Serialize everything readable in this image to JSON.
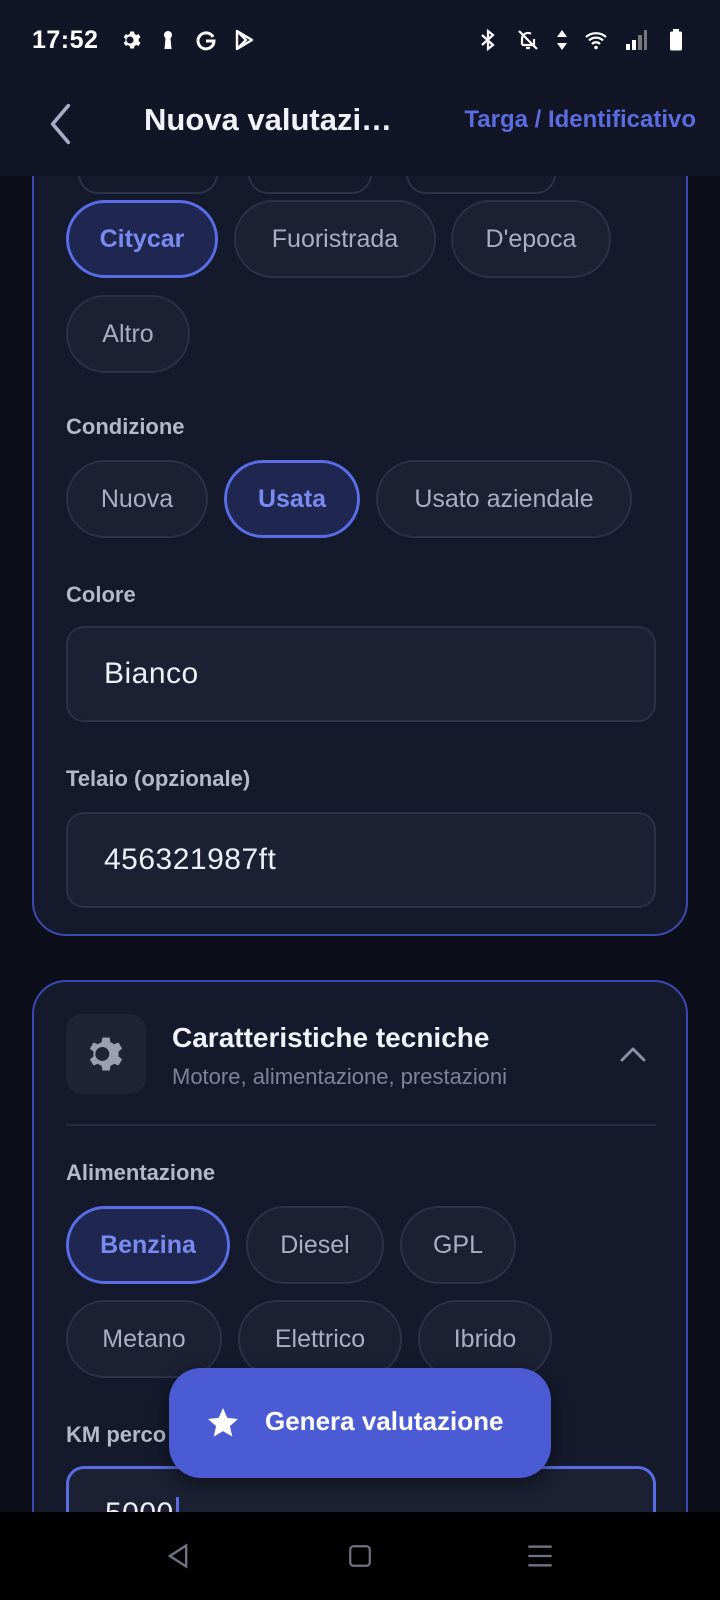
{
  "status_bar": {
    "time": "17:52",
    "left_icons": [
      "settings-icon",
      "keyhole-icon",
      "google-icon",
      "play-store-icon"
    ],
    "right_icons": [
      "bluetooth-icon",
      "bell-off-icon",
      "data-arrows-icon",
      "wifi-icon",
      "signal-icon",
      "battery-icon"
    ]
  },
  "app_bar": {
    "title": "Nuova valutazi…",
    "action": "Targa / Identificativo"
  },
  "vehicle_card": {
    "type_chips": [
      {
        "label": "Citycar",
        "selected": true
      },
      {
        "label": "Fuoristrada",
        "selected": false
      },
      {
        "label": "D'epoca",
        "selected": false
      },
      {
        "label": "Altro",
        "selected": false
      }
    ],
    "condition_label": "Condizione",
    "condition_chips": [
      {
        "label": "Nuova",
        "selected": false
      },
      {
        "label": "Usata",
        "selected": true
      },
      {
        "label": "Usato aziendale",
        "selected": false
      }
    ],
    "color_label": "Colore",
    "color_value": "Bianco",
    "chassis_label": "Telaio (opzionale)",
    "chassis_value": "456321987ft"
  },
  "tech_card": {
    "title": "Caratteristiche tecniche",
    "subtitle": "Motore, alimentazione, prestazioni",
    "fuel_label": "Alimentazione",
    "fuel_chips": [
      {
        "label": "Benzina",
        "selected": true
      },
      {
        "label": "Diesel",
        "selected": false
      },
      {
        "label": "GPL",
        "selected": false
      },
      {
        "label": "Metano",
        "selected": false
      },
      {
        "label": "Elettrico",
        "selected": false
      },
      {
        "label": "Ibrido",
        "selected": false
      }
    ],
    "km_label": "KM perco",
    "km_value": "5000"
  },
  "fab": {
    "label": "Genera valutazione"
  },
  "colors": {
    "accent": "#5a6be6",
    "background": "#0c0f19",
    "card": "#141a2c",
    "fab": "#4b5bd4"
  }
}
